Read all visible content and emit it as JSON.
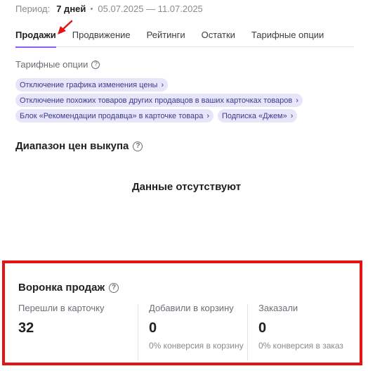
{
  "period": {
    "label": "Период:",
    "value": "7 дней",
    "dates": "05.07.2025 — 11.07.2025"
  },
  "tabs": [
    {
      "label": "Продажи",
      "active": true
    },
    {
      "label": "Продвижение"
    },
    {
      "label": "Рейтинги"
    },
    {
      "label": "Остатки"
    },
    {
      "label": "Тарифные опции"
    }
  ],
  "tariff_options": {
    "title": "Тарифные опции",
    "chips": [
      "Отключение графика изменения цены",
      "Отключение похожих товаров других продавцов в ваших карточках товаров",
      "Блок «Рекомендации продавца» в карточке товара",
      "Подписка «Джем»"
    ]
  },
  "price_range": {
    "title": "Диапазон цен выкупа",
    "empty_text": "Данные отсутствуют"
  },
  "funnel": {
    "title": "Воронка продаж",
    "columns": [
      {
        "label": "Перешли в карточку",
        "value": "32",
        "conversion": ""
      },
      {
        "label": "Добавили в корзину",
        "value": "0",
        "conversion": "0% конверсия в корзину"
      },
      {
        "label": "Заказали",
        "value": "0",
        "conversion": "0% конверсия в заказ"
      }
    ]
  },
  "colors": {
    "accent": "#8b5cf6",
    "chip_bg": "#e6e5f9",
    "chip_text": "#3b3a8a",
    "highlight_border": "#e51414"
  }
}
